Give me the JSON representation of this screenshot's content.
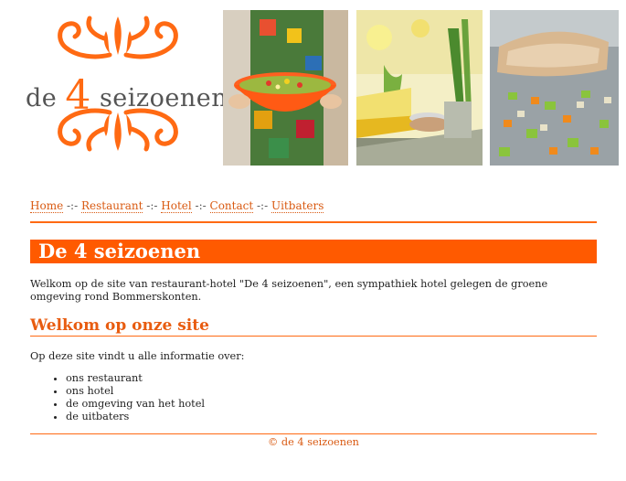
{
  "brand": {
    "prefix": "de",
    "number": "4",
    "suffix": "seizoenen",
    "accent_color": "#ff6a13"
  },
  "nav": {
    "items": [
      "Home",
      "Restaurant",
      "Hotel",
      "Contact",
      "Uitbaters"
    ],
    "separator": "-:-"
  },
  "main": {
    "title": "De 4 seizoenen",
    "intro": "Welkom op de site van restaurant-hotel \"De 4 seizoenen\", een sympathiek hotel gelegen de groene omgeving rond Bommerskonten.",
    "section_title": "Welkom op onze site",
    "lead": "Op deze site vindt u alle informatie over:",
    "list": [
      "ons restaurant",
      "ons hotel",
      "de omgeving van het hotel",
      "de uitbaters"
    ]
  },
  "footer": {
    "text": "© de 4 seizoenen"
  }
}
